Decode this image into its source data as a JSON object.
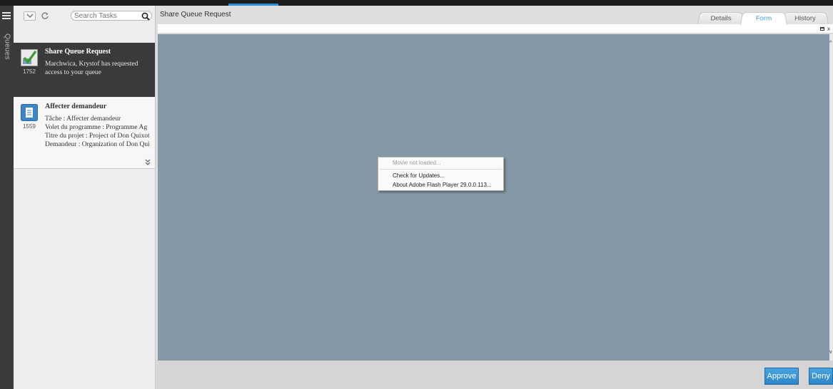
{
  "rail": {
    "label": "Queues"
  },
  "tasks": {
    "search_placeholder": "Search Tasks",
    "items": [
      {
        "title": "Share Queue Request",
        "number": "1752",
        "desc_lines": [
          "Marchwica, Krystof has requested access to your queue"
        ],
        "icon": "approve-check-icon"
      },
      {
        "title": "Affecter demandeur",
        "number": "1559",
        "desc_lines": [
          "Tâche : Affecter demandeur",
          "Volet du programme : Programme Ag",
          "Titre du projet : Project of Don Quixote",
          "Demandeur : Organization of Don Qui"
        ],
        "icon": "document-icon"
      }
    ]
  },
  "main": {
    "title": "Share Queue Request",
    "tabs": [
      {
        "label": "Details",
        "active": false
      },
      {
        "label": "Form",
        "active": true
      },
      {
        "label": "History",
        "active": false
      }
    ],
    "minimize_label": "x"
  },
  "context_menu": {
    "items": [
      {
        "label": "Movie not loaded...",
        "disabled": true
      },
      {
        "label": "Check for Updates...",
        "disabled": false
      },
      {
        "label": "About Adobe Flash Player 29.0.0.113...",
        "disabled": false
      }
    ]
  },
  "footer": {
    "approve_label": "Approve",
    "deny_label": "Deny"
  },
  "colors": {
    "flash_bg": "#8499a5",
    "selected_task_bg": "#3a3a3a",
    "accent": "#2f8fd8",
    "button": "#3a96d8"
  }
}
